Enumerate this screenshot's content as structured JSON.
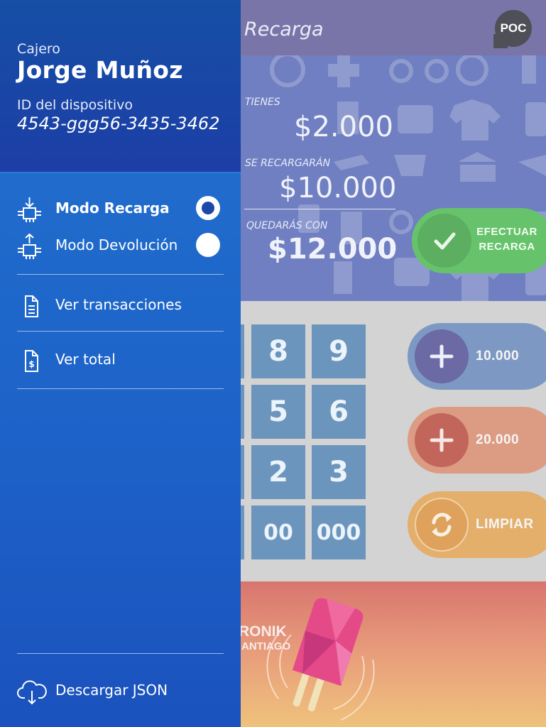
{
  "app": {
    "title": "Recarga",
    "badge": "POC"
  },
  "balance": {
    "current_label": "TIENES",
    "current_value": "$2.000",
    "recharge_label": "SE RECARGARÁN",
    "recharge_value": "$10.000",
    "result_label": "QUEDARÁS CON",
    "result_value": "$12.000"
  },
  "confirm_button": {
    "line1": "EFECTUAR",
    "line2": "RECARGA",
    "icon": "check-icon"
  },
  "keypad": {
    "keys": [
      "8",
      "9",
      "5",
      "6",
      "2",
      "3",
      "00",
      "000"
    ]
  },
  "quick_actions": [
    {
      "label": "10.000",
      "icon": "plus-icon",
      "color": "#7d99c3",
      "circle_color": "#6b6aa4"
    },
    {
      "label": "20.000",
      "icon": "plus-icon",
      "color": "#dc9c84",
      "circle_color": "#c2665b"
    },
    {
      "label": "LIMPIAR",
      "icon": "refresh-icon",
      "color": "#e4ae6b",
      "circle_color": "#dea25d"
    }
  ],
  "promo": {
    "brand_line1": "RONIK",
    "brand_line2": "ANTIAGO"
  },
  "drawer": {
    "cashier_label": "Cajero",
    "cashier_name": "Jorge Muñoz",
    "device_label": "ID del dispositivo",
    "device_id": "4543-ggg56-3435-3462",
    "modes": [
      {
        "label": "Modo Recarga",
        "icon": "device-download-icon",
        "selected": true
      },
      {
        "label": "Modo Devolución",
        "icon": "device-upload-icon",
        "selected": false
      }
    ],
    "links": {
      "transactions": "Ver transacciones",
      "total": "Ver total",
      "download": "Descargar JSON"
    }
  },
  "colors": {
    "drawer_bg": "#1d62c8",
    "drawer_header": "#164fa6",
    "header_bg": "#7a75a8",
    "balance_bg": "#6f7fc1",
    "confirm_green": "#67c26c",
    "key_blue": "#6c95bd"
  }
}
